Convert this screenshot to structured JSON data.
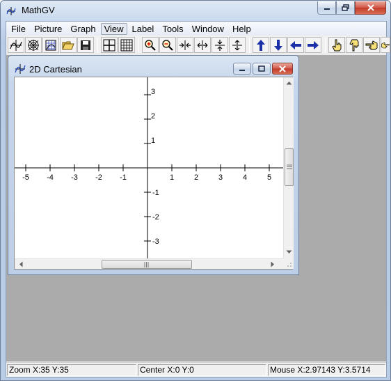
{
  "app": {
    "title": "MathGV"
  },
  "menu": {
    "items": [
      "File",
      "Picture",
      "Graph",
      "View",
      "Label",
      "Tools",
      "Window",
      "Help"
    ],
    "active": "View"
  },
  "toolbar": {
    "buttons": [
      "graph-function-icon",
      "polar-graph-icon",
      "3d-graph-icon",
      "open-folder-icon",
      "save-disk-icon",
      "axes-icon",
      "grid-icon",
      "zoom-in-icon",
      "zoom-out-icon",
      "compress-horizontal-icon",
      "expand-horizontal-icon",
      "compress-vertical-icon",
      "expand-vertical-icon",
      "arrow-up-icon",
      "arrow-down-icon",
      "arrow-left-icon",
      "arrow-right-icon",
      "hand-pointer-up-icon",
      "hand-pointer-down-icon",
      "hand-pointer-left-icon",
      "hand-pointer-right-icon"
    ]
  },
  "child_window": {
    "title": "2D Cartesian"
  },
  "graph": {
    "x_ticks": [
      "-5",
      "-4",
      "-3",
      "-2",
      "-1",
      "1",
      "2",
      "3",
      "4",
      "5"
    ],
    "y_ticks_pos": [
      "3",
      "2",
      "1"
    ],
    "y_ticks_neg": [
      "-1",
      "-2",
      "-3"
    ]
  },
  "status": {
    "zoom": "Zoom X:35 Y:35",
    "center": "Center X:0 Y:0",
    "mouse": "Mouse X:2.97143 Y:3.5714"
  },
  "colors": {
    "accent_arrow": "#1a2fa8",
    "close_button": "#c7432f"
  }
}
